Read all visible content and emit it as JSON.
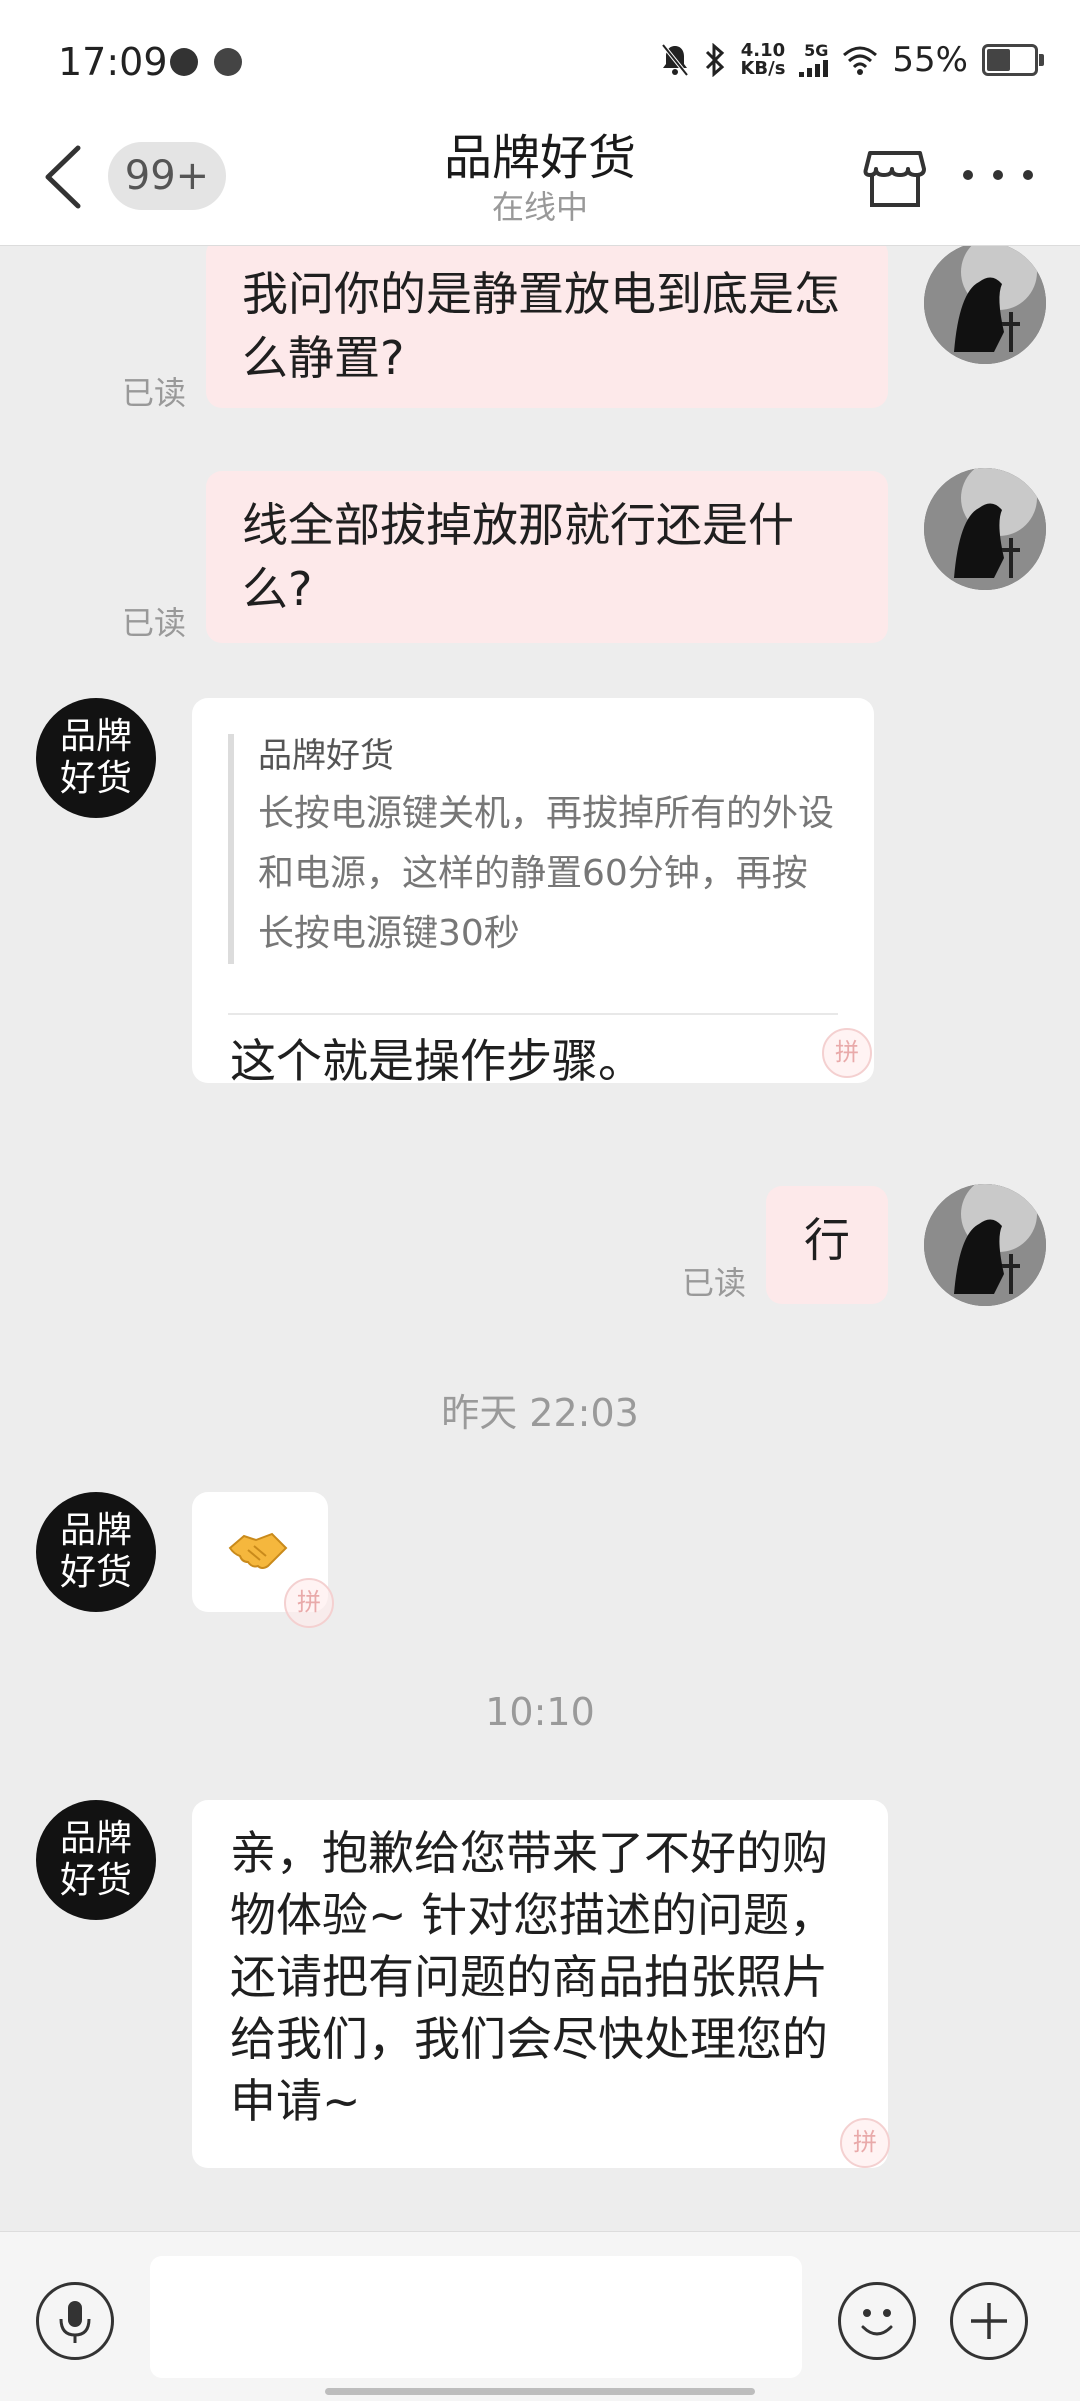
{
  "status_bar": {
    "time": "17:09",
    "net_speed_value": "4.10",
    "net_speed_unit": "KB/s",
    "network": "5G",
    "battery": "55%",
    "battery_level": 0.55
  },
  "header": {
    "title": "品牌好货",
    "subtitle": "在线中",
    "unread_badge": "99+"
  },
  "shop_avatar_text": "品牌好货",
  "messages": [
    {
      "text": "我问你的是静置放电到底是怎么静置?",
      "read": "已读"
    },
    {
      "text": "线全部拔掉放那就行还是什么?",
      "read": "已读"
    },
    {
      "quote_author": "品牌好货",
      "quote_text": "长按电源键关机，再拔掉所有的外设和电源，这样的静置60分钟，再按长按电源键30秒",
      "text": "这个就是操作步骤。"
    },
    {
      "text": "行",
      "read": "已读"
    },
    {
      "timestamp": "昨天 22:03"
    },
    {
      "emoji": "handshake-emoji"
    },
    {
      "timestamp": "10:10"
    },
    {
      "text": "亲，抱歉给您带来了不好的购物体验~ 针对您描述的问题，还请把有问题的商品拍张照片给我们，我们会尽快处理您的申请~"
    }
  ],
  "input": {
    "value": "",
    "placeholder": ""
  },
  "colors": {
    "outgoing_bubble": "#fde9ea",
    "incoming_bubble": "#ffffff",
    "background": "#ededed"
  }
}
